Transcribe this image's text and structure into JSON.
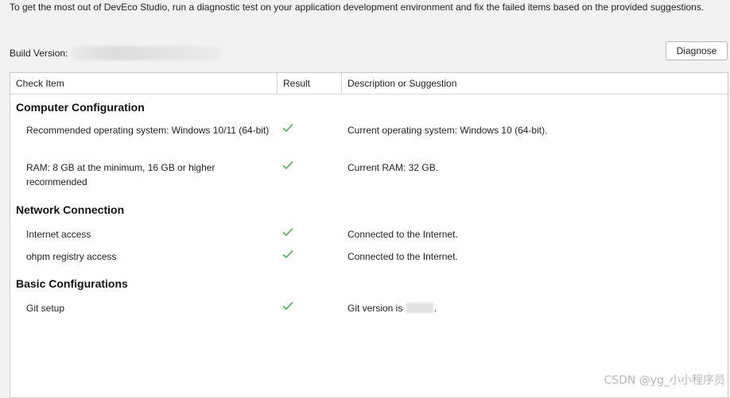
{
  "intro_text": "To get the most out of DevEco Studio, run a diagnostic test on your application development environment and fix the failed items based on the provided suggestions.",
  "build": {
    "label": "Build Version:"
  },
  "diagnose_button": "Diagnose",
  "table": {
    "headers": [
      "Check Item",
      "Result",
      "Description or Suggestion"
    ],
    "sections": [
      {
        "title": "Computer Configuration",
        "rows": [
          {
            "item": "Recommended operating system: Windows 10/11 (64-bit)",
            "result": "check-icon",
            "desc": "Current operating system: Windows 10 (64-bit)."
          },
          {
            "item": "RAM: 8 GB at the minimum, 16 GB or higher recommended",
            "result": "check-icon",
            "desc": "Current RAM: 32 GB."
          }
        ]
      },
      {
        "title": "Network Connection",
        "rows": [
          {
            "item": "Internet access",
            "result": "check-icon",
            "desc": "Connected to the Internet."
          },
          {
            "item": "ohpm registry access",
            "result": "check-icon",
            "desc": "Connected to the Internet."
          }
        ]
      },
      {
        "title": "Basic Configurations",
        "rows": [
          {
            "item": "Git setup",
            "result": "check-icon",
            "desc_prefix": "Git version is",
            "desc_suffix": "."
          }
        ]
      }
    ]
  },
  "watermark": "CSDN @yg_小小程序员",
  "colors": {
    "check": "#4caf50",
    "border": "#c9c9c9",
    "background": "#f2f2f2"
  }
}
